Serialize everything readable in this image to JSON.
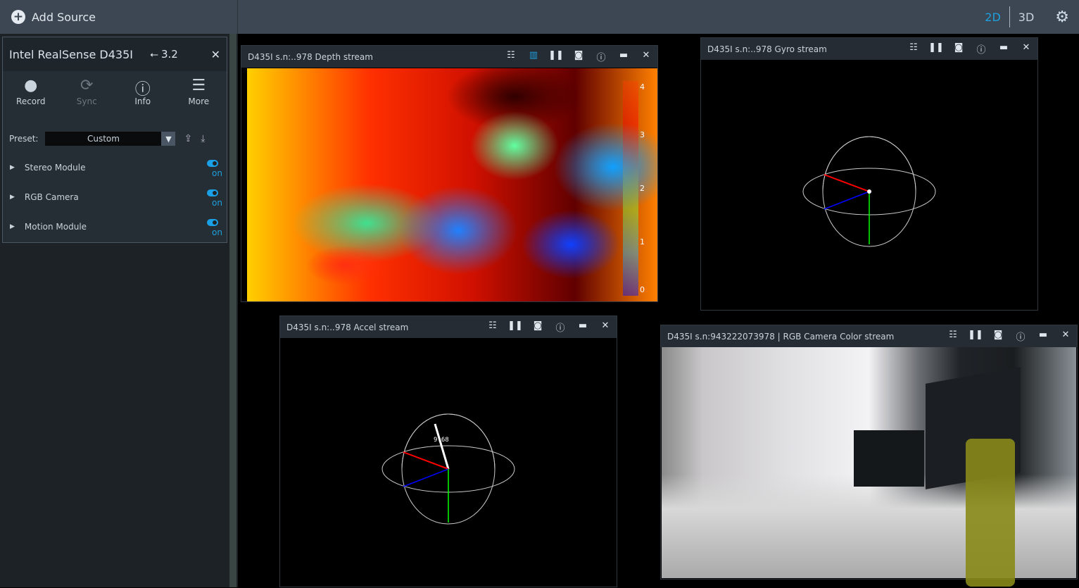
{
  "topbar": {
    "add_source": "Add Source",
    "mode_2d": "2D",
    "mode_3d": "3D",
    "settings_icon": "gear-icon",
    "active_mode": "2D",
    "accent": "#1ea0dc"
  },
  "device": {
    "name": "Intel RealSense D435I",
    "usb": "3.2",
    "usb_icon": "usb-icon",
    "buttons": [
      {
        "label": "Record",
        "icon": "record-icon"
      },
      {
        "label": "Sync",
        "icon": "sync-icon",
        "disabled": true
      },
      {
        "label": "Info",
        "icon": "info-icon"
      },
      {
        "label": "More",
        "icon": "menu-icon"
      }
    ],
    "preset_label": "Preset:",
    "preset_value": "Custom",
    "modules": [
      {
        "label": "Stereo Module",
        "state": "on"
      },
      {
        "label": "RGB Camera",
        "state": "on"
      },
      {
        "label": "Motion Module",
        "state": "on"
      }
    ]
  },
  "streams": {
    "depth": {
      "title": "D435I s.n:..978 Depth stream",
      "colorbar": [
        "4",
        "3",
        "2",
        "1",
        "0"
      ]
    },
    "gyro": {
      "title": "D435I s.n:..978 Gyro stream"
    },
    "accel": {
      "title": "D435I s.n:..978 Accel stream",
      "magnitude": "9.68"
    },
    "rgb": {
      "title": "D435I s.n:943222073978 | RGB Camera Color stream"
    }
  }
}
